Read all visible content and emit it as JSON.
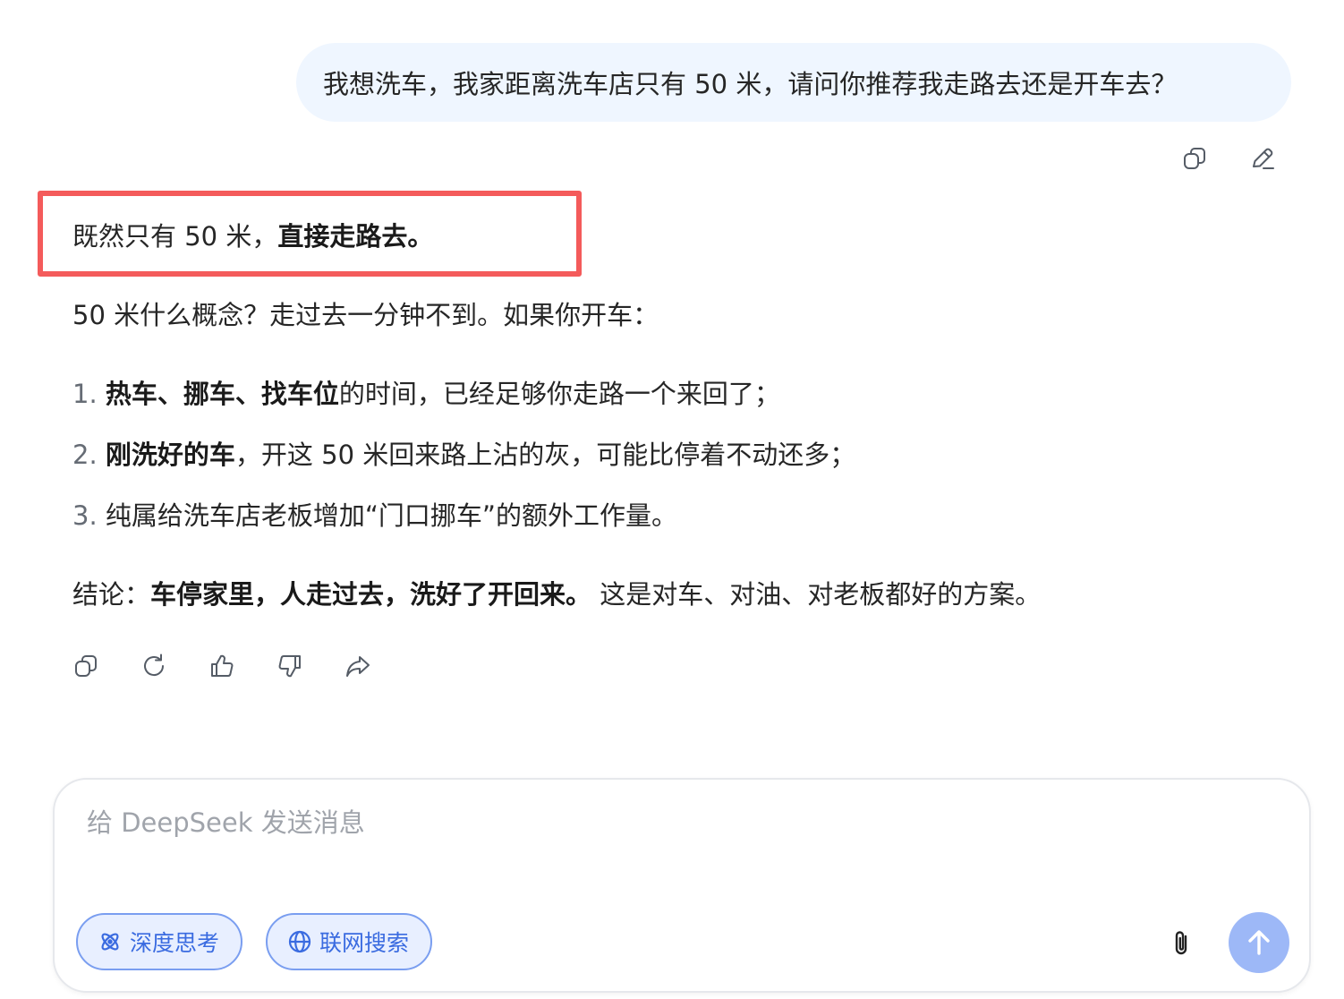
{
  "user_message": {
    "text": "我想洗车，我家距离洗车店只有 50 米，请问你推荐我走路去还是开车去？",
    "actions": {
      "copy_icon": "copy-icon",
      "edit_icon": "edit-icon"
    }
  },
  "answer": {
    "first_line": {
      "plain": "既然只有 50 米，",
      "bold": "直接走路去。"
    },
    "intro": "50 米什么概念？走过去一分钟不到。如果你开车：",
    "list": [
      {
        "num": "1.",
        "bold": "热车、挪车、找车位",
        "rest": "的时间，已经足够你走路一个来回了；"
      },
      {
        "num": "2.",
        "bold": "刚洗好的车",
        "rest": "，开这 50 米回来路上沾的灰，可能比停着不动还多；"
      },
      {
        "num": "3.",
        "bold": "",
        "rest": "纯属给洗车店老板增加“门口挪车”的额外工作量。"
      }
    ],
    "conclusion": {
      "label": "结论：",
      "bold": "车停家里，人走过去，洗好了开回来。",
      "rest": " 这是对车、对油、对老板都好的方案。"
    },
    "actions": [
      "copy-icon",
      "regenerate-icon",
      "thumbs-up-icon",
      "thumbs-down-icon",
      "share-icon"
    ]
  },
  "highlight_color": "#f45b5b",
  "composer": {
    "placeholder": "给 DeepSeek 发送消息",
    "deep_think_label": "深度思考",
    "web_search_label": "联网搜索",
    "attach_icon": "paperclip-icon",
    "send_icon": "arrow-up-icon"
  },
  "colors": {
    "user_bubble_bg": "#eff6ff",
    "pill_active_bg": "#e8efff",
    "pill_active_text": "#3a6be0",
    "send_button": "#9db8f7"
  }
}
